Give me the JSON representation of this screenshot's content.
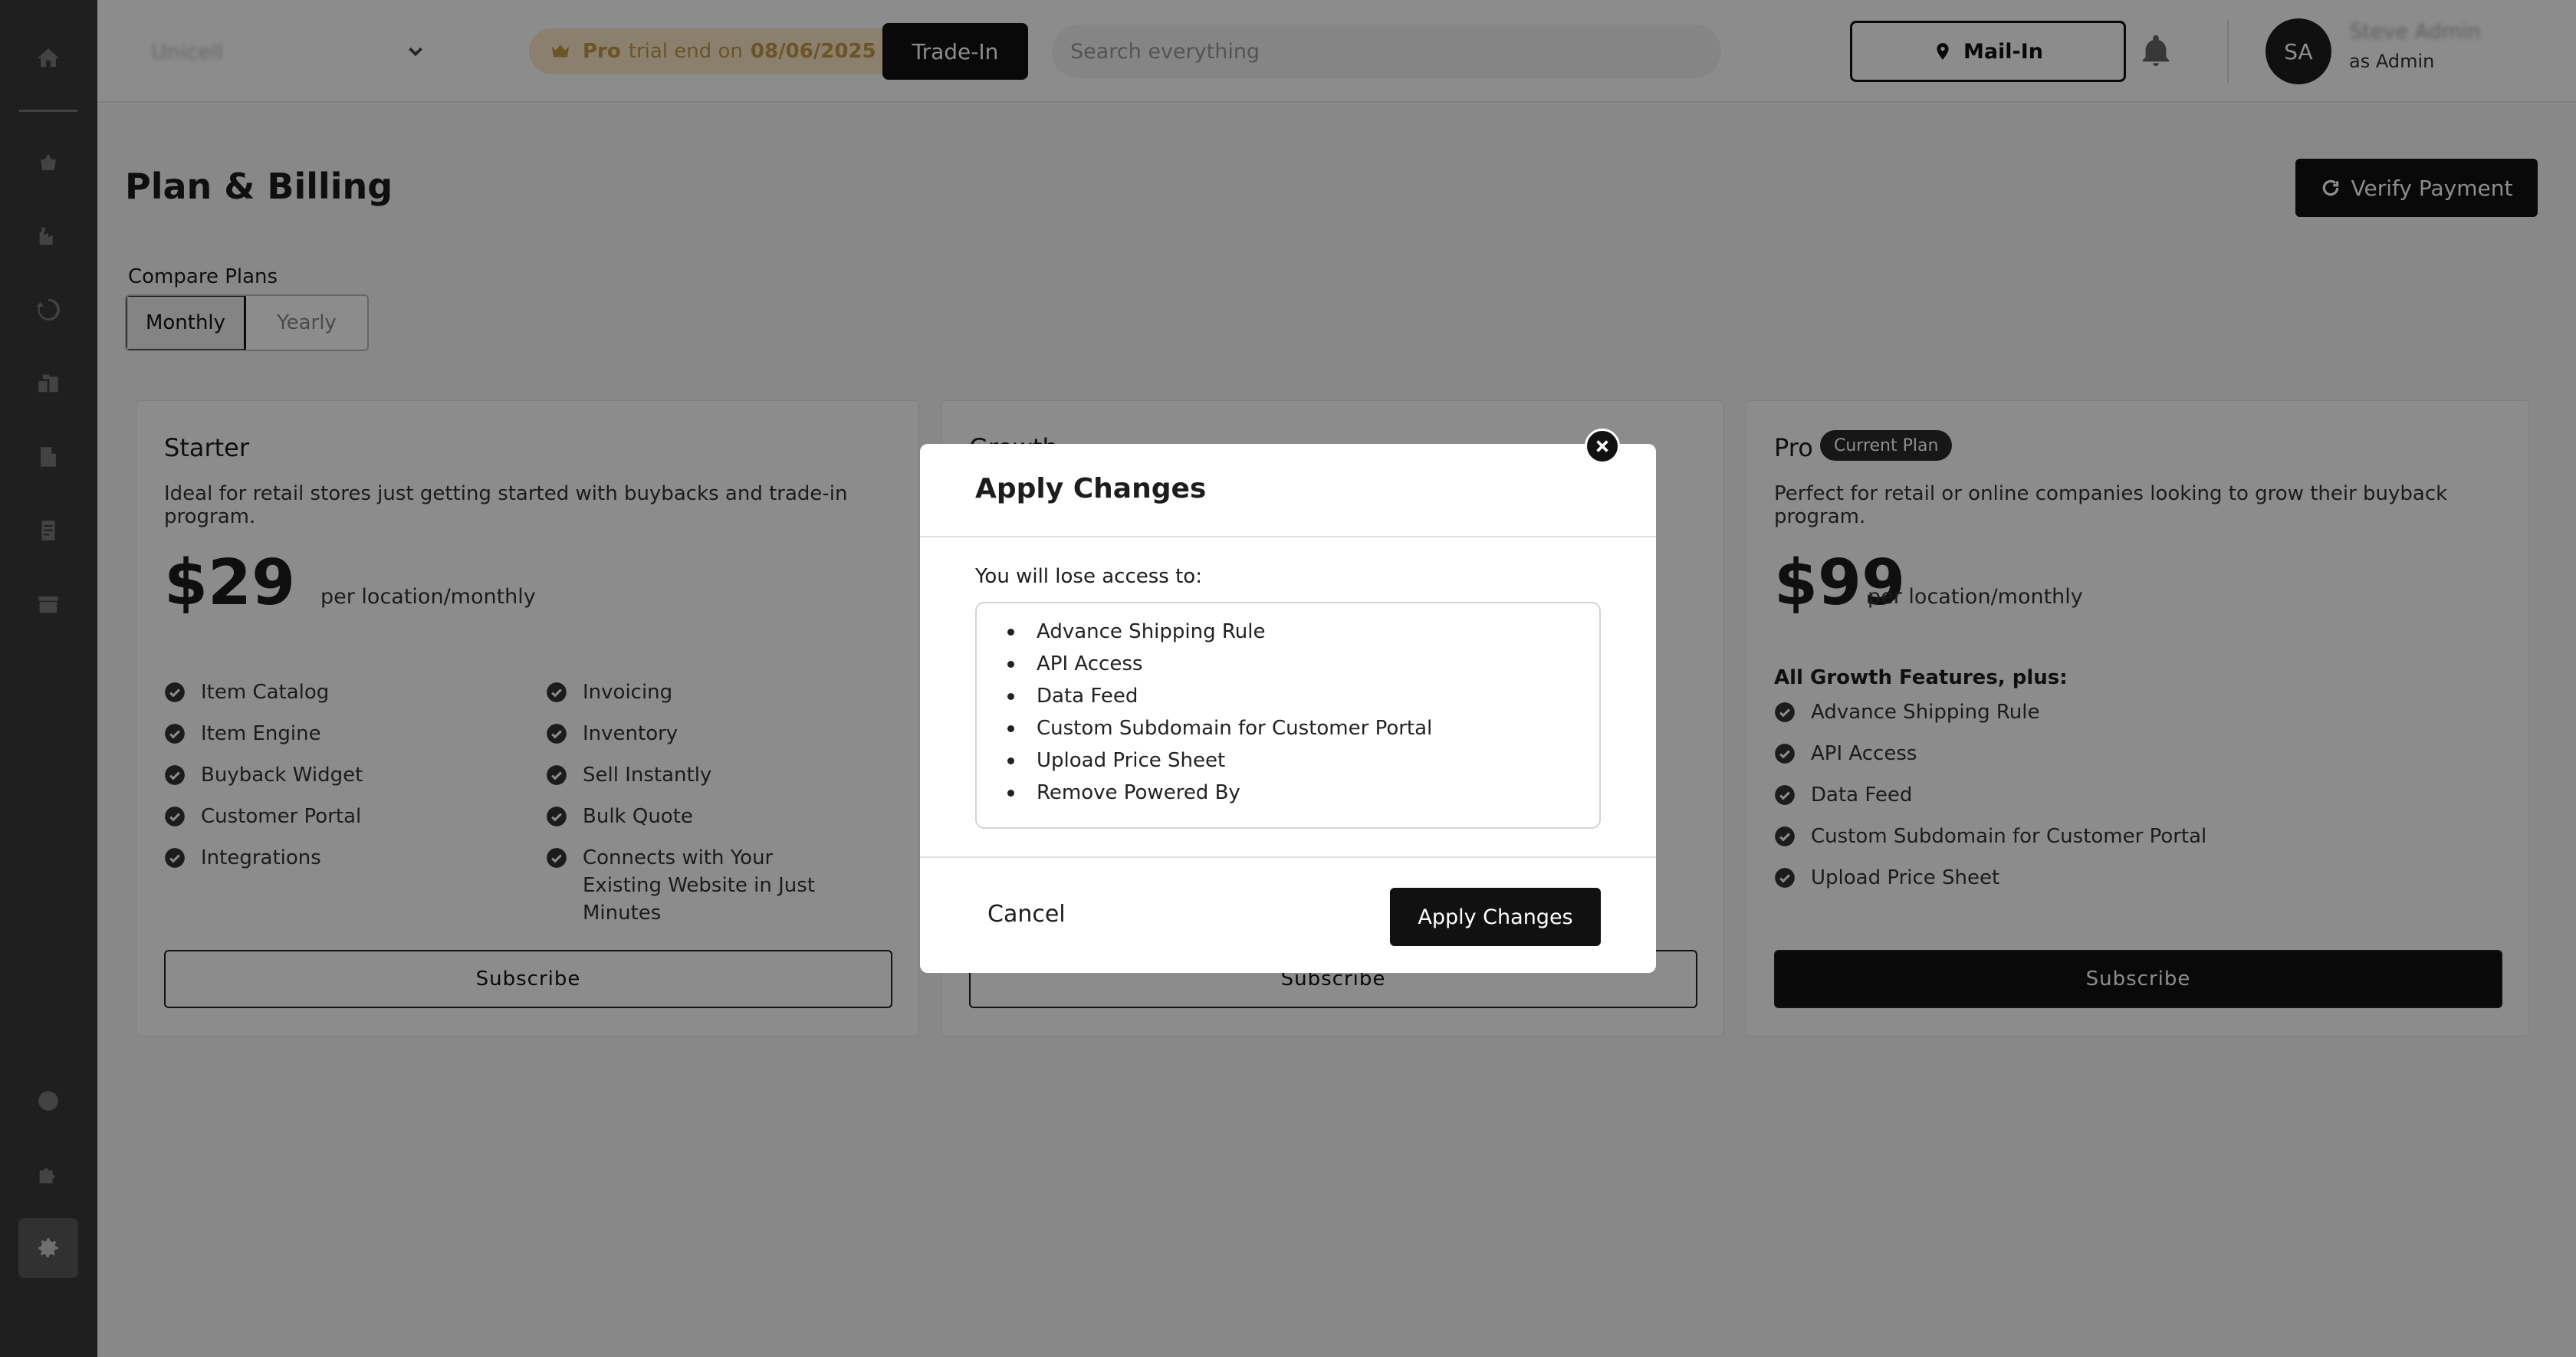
{
  "header": {
    "store_name": "Unicell",
    "trial_prefix": "Pro",
    "trial_text": "trial end on",
    "trial_date": "08/06/2025",
    "tradein_label": "Trade-In",
    "search_placeholder": "Search everything",
    "mailin_label": "Mail-In",
    "avatar_initials": "SA",
    "user_name": "Steve Admin",
    "user_role": "as Admin"
  },
  "page": {
    "title": "Plan & Billing",
    "verify_label": "Verify Payment",
    "compare_label": "Compare Plans",
    "billing_toggle": {
      "monthly": "Monthly",
      "yearly": "Yearly",
      "selected": "Monthly"
    }
  },
  "plans": {
    "starter": {
      "name": "Starter",
      "description": "Ideal for retail stores just getting started with buybacks and trade-in program.",
      "price": "$29",
      "per": "per location/monthly",
      "features_col1": [
        "Item Catalog",
        "Item Engine",
        "Buyback Widget",
        "Customer Portal",
        "Integrations"
      ],
      "features_col2": [
        "Invoicing",
        "Inventory",
        "Sell Instantly",
        "Bulk Quote",
        "Connects with Your Existing Website in Just Minutes"
      ],
      "subscribe_label": "Subscribe"
    },
    "growth": {
      "name": "Growth",
      "subscribe_label": "Subscribe"
    },
    "pro": {
      "name": "Pro",
      "badge": "Current Plan",
      "description": "Perfect for retail or online companies looking to grow their buyback program.",
      "price": "$99",
      "per": "per location/monthly",
      "plus_label": "All Growth Features, plus:",
      "features": [
        "Advance Shipping Rule",
        "API Access",
        "Data Feed",
        "Custom Subdomain for Customer Portal",
        "Upload Price Sheet"
      ],
      "subscribe_label": "Subscribe"
    }
  },
  "modal": {
    "title": "Apply Changes",
    "subtitle": "You will lose access to:",
    "items": [
      "Advance Shipping Rule",
      "API Access",
      "Data Feed",
      "Custom Subdomain for Customer Portal",
      "Upload Price Sheet",
      "Remove Powered By"
    ],
    "cancel_label": "Cancel",
    "apply_label": "Apply Changes"
  },
  "colors": {
    "sidebar_bg": "#3a3a3a",
    "primary_dark": "#111111",
    "trial_badge_bg": "#fbe9c6",
    "trial_badge_text": "#c29a4a",
    "overlay": "rgba(0,0,0,0.45)"
  },
  "sidebar_icons": [
    "home-icon",
    "basket-icon",
    "warehouse-icon",
    "cycle-icon",
    "boxes-icon",
    "building-icon",
    "document-icon",
    "archive-icon",
    "help-icon",
    "puzzle-icon",
    "gear-icon"
  ]
}
